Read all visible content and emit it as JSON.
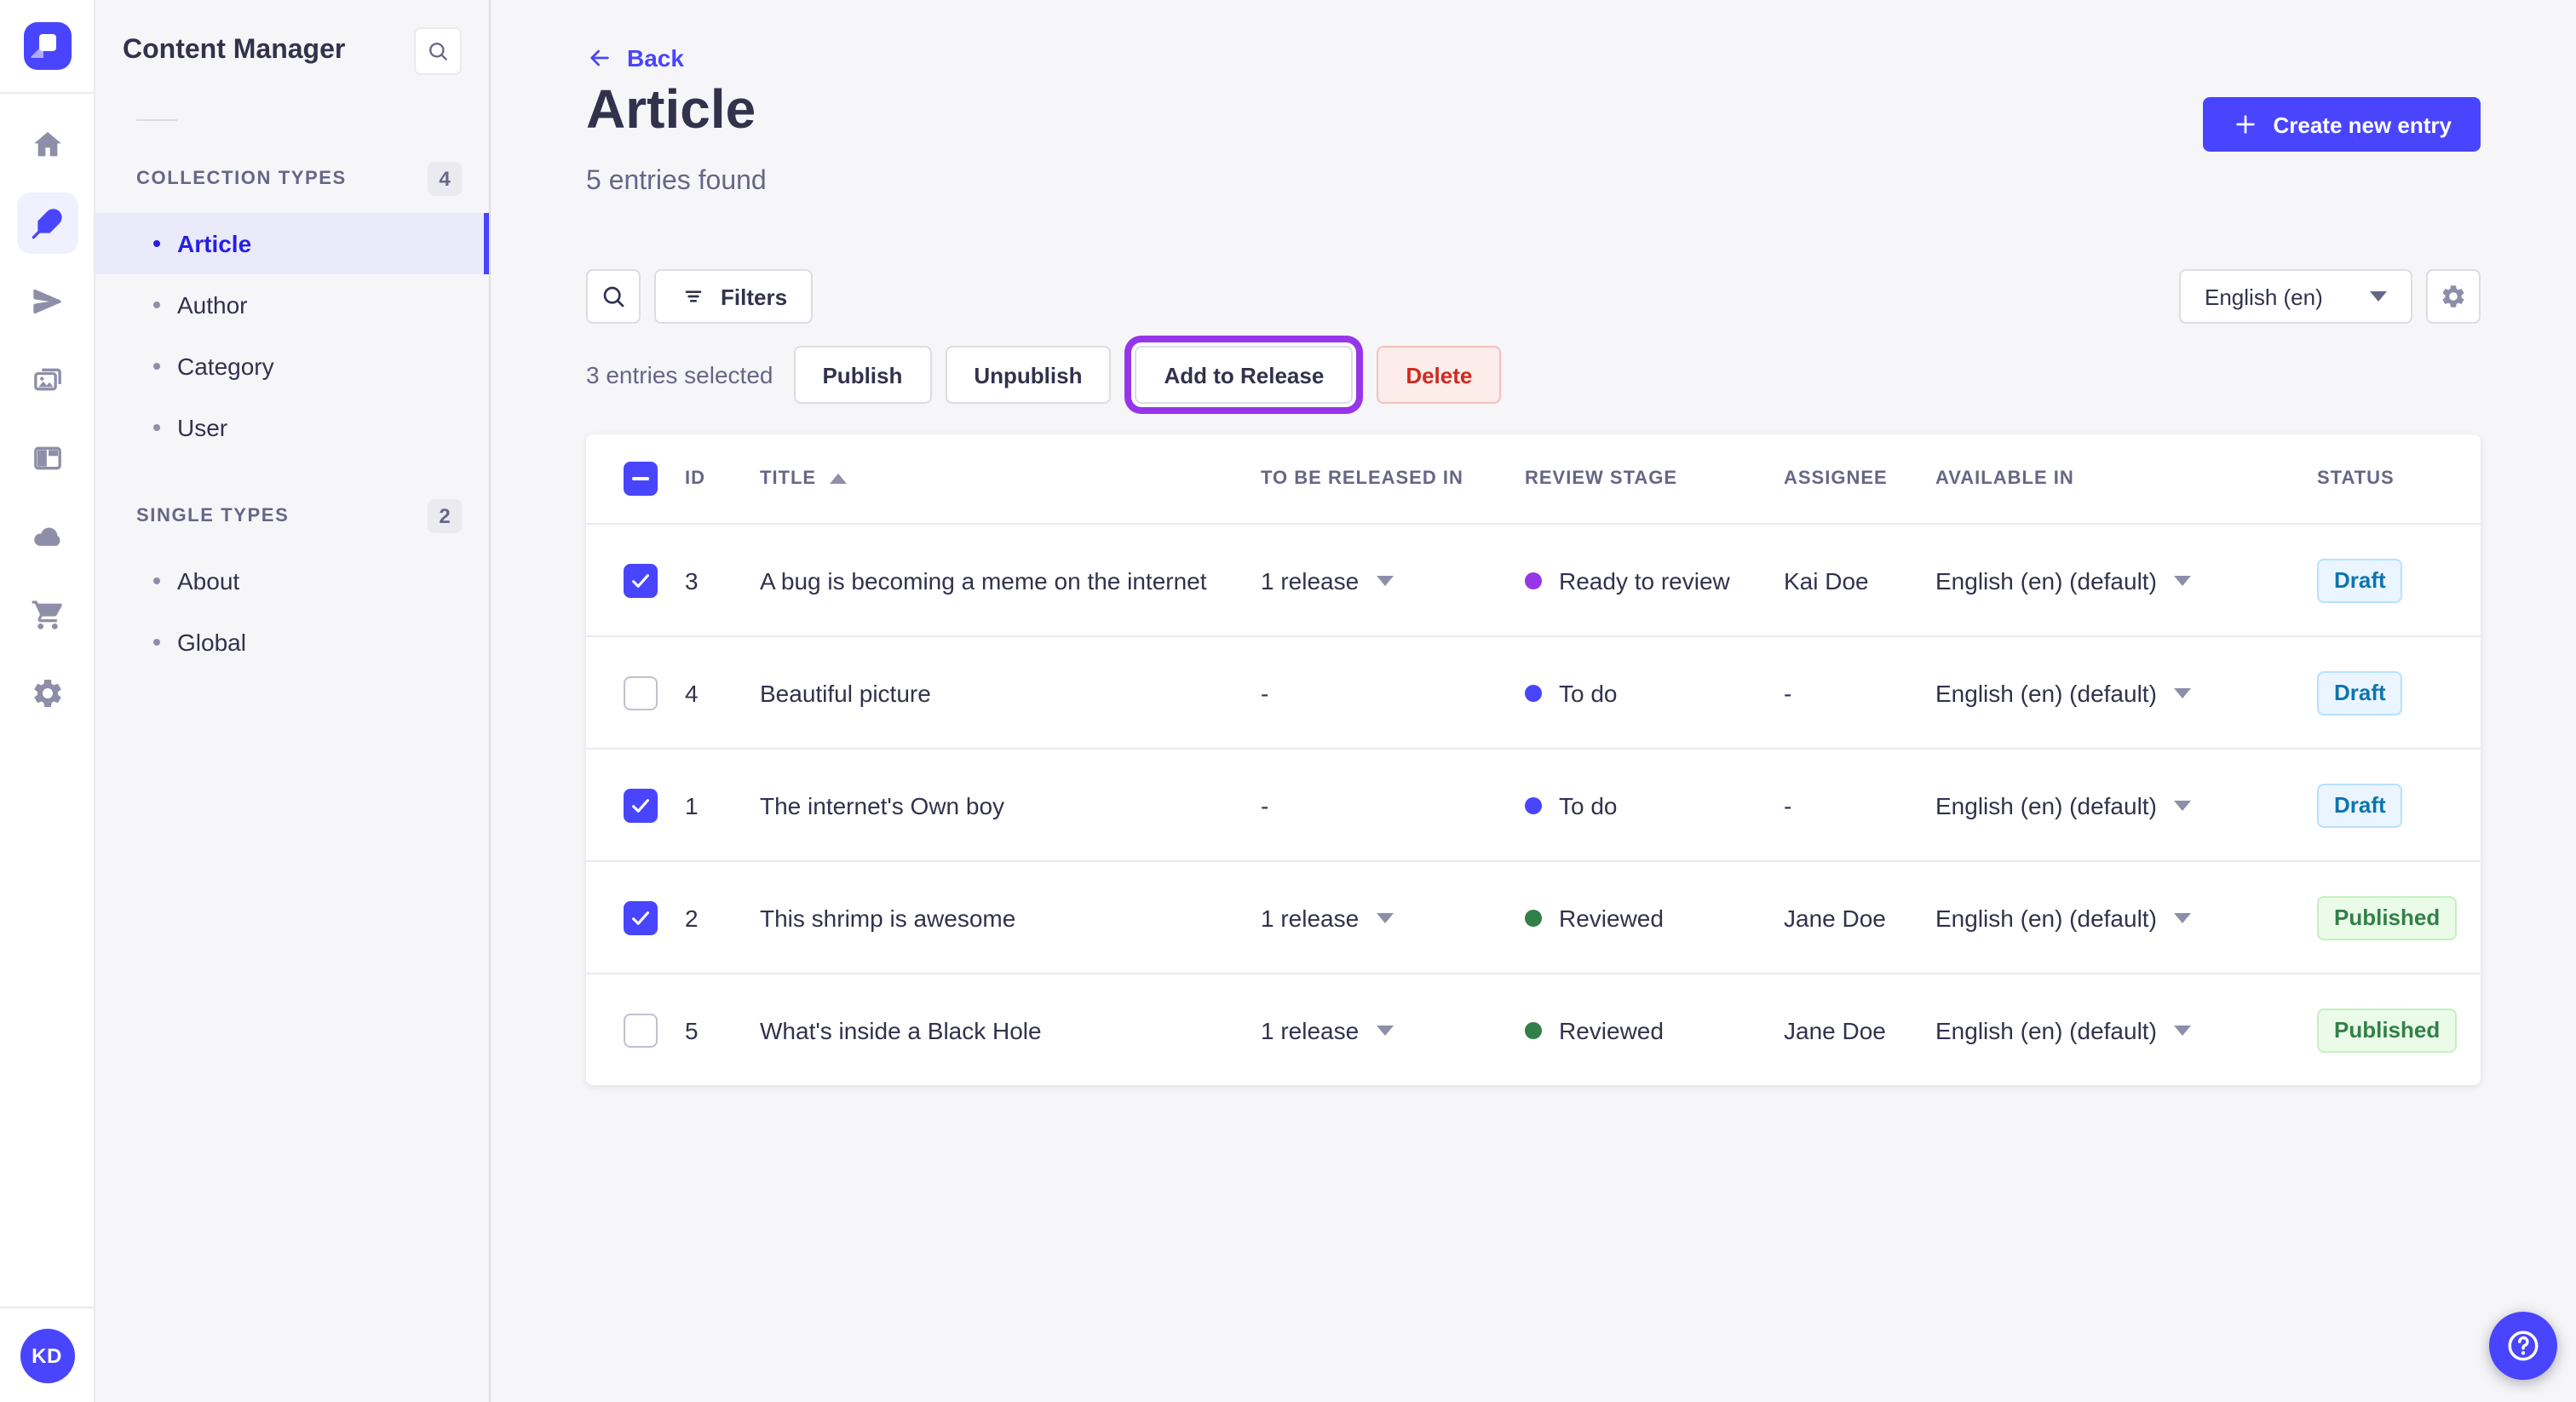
{
  "nav_rail": {
    "items": [
      "home",
      "content-manager",
      "releases",
      "media-library",
      "content-type-builder",
      "cloud",
      "marketplace",
      "settings"
    ],
    "active_item": "content-manager",
    "avatar_initials": "KD"
  },
  "sidebar": {
    "title": "Content Manager",
    "sections": [
      {
        "label": "COLLECTION TYPES",
        "count": "4",
        "items": [
          {
            "label": "Article",
            "active": true
          },
          {
            "label": "Author",
            "active": false
          },
          {
            "label": "Category",
            "active": false
          },
          {
            "label": "User",
            "active": false
          }
        ]
      },
      {
        "label": "SINGLE TYPES",
        "count": "2",
        "items": [
          {
            "label": "About",
            "active": false
          },
          {
            "label": "Global",
            "active": false
          }
        ]
      }
    ]
  },
  "header": {
    "back": "Back",
    "title": "Article",
    "subtitle": "5 entries found",
    "create_button": "Create new entry"
  },
  "toolbar": {
    "filters": "Filters",
    "locale": "English (en)"
  },
  "selection": {
    "summary": "3 entries selected",
    "buttons": {
      "publish": "Publish",
      "unpublish": "Unpublish",
      "add_to_release": "Add to Release",
      "delete": "Delete"
    }
  },
  "table": {
    "headers": {
      "id": "ID",
      "title": "TITLE",
      "released": "TO BE RELEASED IN",
      "review": "REVIEW STAGE",
      "assignee": "ASSIGNEE",
      "available": "AVAILABLE IN",
      "status": "STATUS"
    },
    "sort": {
      "column": "TITLE",
      "direction": "asc"
    },
    "rows": [
      {
        "checked": true,
        "id": "3",
        "title": "A bug is becoming a meme on the internet",
        "release": "1 release",
        "has_release_menu": true,
        "stage": "Ready to review",
        "stage_color": "#9736e8",
        "assignee": "Kai Doe",
        "locale": "English (en) (default)",
        "status": "Draft",
        "status_variant": "draft"
      },
      {
        "checked": false,
        "id": "4",
        "title": "Beautiful picture",
        "release": "-",
        "has_release_menu": false,
        "stage": "To do",
        "stage_color": "#4945ff",
        "assignee": "-",
        "locale": "English (en) (default)",
        "status": "Draft",
        "status_variant": "draft"
      },
      {
        "checked": true,
        "id": "1",
        "title": "The internet's Own boy",
        "release": "-",
        "has_release_menu": false,
        "stage": "To do",
        "stage_color": "#4945ff",
        "assignee": "-",
        "locale": "English (en) (default)",
        "status": "Draft",
        "status_variant": "draft"
      },
      {
        "checked": true,
        "id": "2",
        "title": "This shrimp is awesome",
        "release": "1 release",
        "has_release_menu": true,
        "stage": "Reviewed",
        "stage_color": "#328048",
        "assignee": "Jane Doe",
        "locale": "English (en) (default)",
        "status": "Published",
        "status_variant": "published"
      },
      {
        "checked": false,
        "id": "5",
        "title": "What's inside a Black Hole",
        "release": "1 release",
        "has_release_menu": true,
        "stage": "Reviewed",
        "stage_color": "#328048",
        "assignee": "Jane Doe",
        "locale": "English (en) (default)",
        "status": "Published",
        "status_variant": "published"
      }
    ]
  },
  "colors": {
    "primary": "#4945ff",
    "highlight_ring": "#9736e8",
    "stage_ready_to_review": "#9736e8",
    "stage_to_do": "#4945ff",
    "stage_reviewed": "#328048",
    "draft_text": "#0c75af",
    "published_text": "#328048",
    "delete_text": "#d02b20"
  }
}
